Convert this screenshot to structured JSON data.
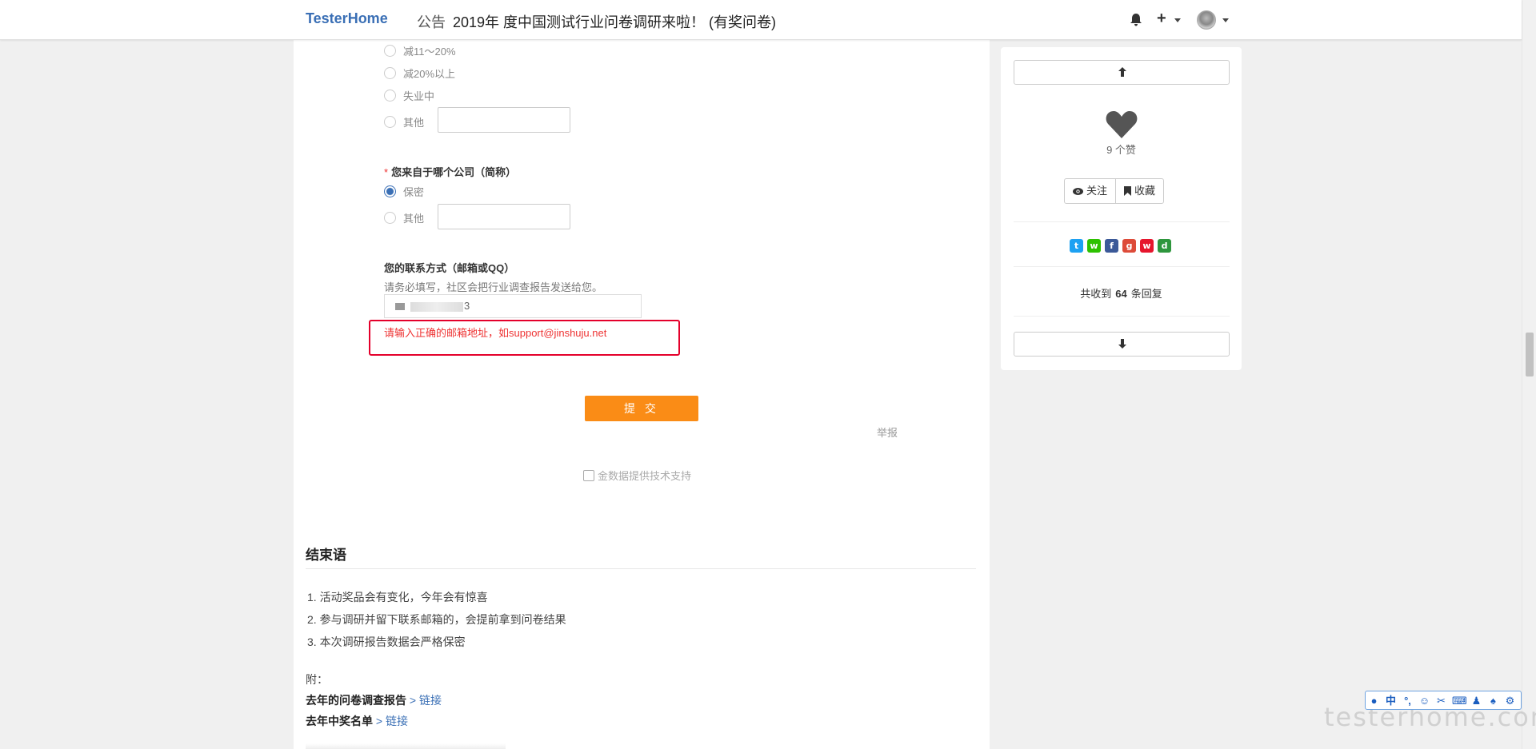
{
  "navbar": {
    "brand": "TesterHome",
    "notice_tag": "公告",
    "notice_title": "2019年 度中国测试行业问卷调研来啦！ (有奖问卷)",
    "icons": [
      "bell-icon",
      "plus-icon",
      "avatar"
    ]
  },
  "survey": {
    "salary_options": [
      "减11～20%",
      "减20%以上",
      "失业中",
      "其他"
    ],
    "company_question": {
      "required_mark": "*",
      "label": "您来自于哪个公司（简称）",
      "options": [
        "保密",
        "其他"
      ],
      "selected": "保密"
    },
    "contact_question": {
      "label": "您的联系方式（邮箱或QQ）",
      "hint": "请务必填写，社区会把行业调查报告发送给您。",
      "value_suffix": "3",
      "error": "请输入正确的邮箱地址，如support@jinshuju.net"
    },
    "submit_label": "提 交",
    "report_label": "举报",
    "powered_by": "金数据提供技术支持"
  },
  "closing": {
    "title": "结束语",
    "items": [
      "1. 活动奖品会有变化，今年会有惊喜",
      "2. 参与调研并留下联系邮箱的，会提前拿到问卷结果",
      "3. 本次调研报告数据会严格保密"
    ],
    "appendix_label": "附：",
    "links": [
      {
        "label": "去年的问卷调查报告",
        "link": "> 链接"
      },
      {
        "label": "去年中奖名单",
        "link": "> 链接"
      }
    ]
  },
  "sidebar": {
    "likes": "9 个赞",
    "follow": "关注",
    "favorite": "收藏",
    "share_icons": [
      "twitter-icon",
      "wechat-icon",
      "facebook-icon",
      "google-plus-icon",
      "weibo-icon",
      "douban-icon"
    ],
    "reply_prefix": "共收到",
    "reply_count": "64",
    "reply_suffix": "条回复"
  },
  "ime": {
    "mode": "中",
    "punct": "°,"
  },
  "watermark": "testerhome.com"
}
